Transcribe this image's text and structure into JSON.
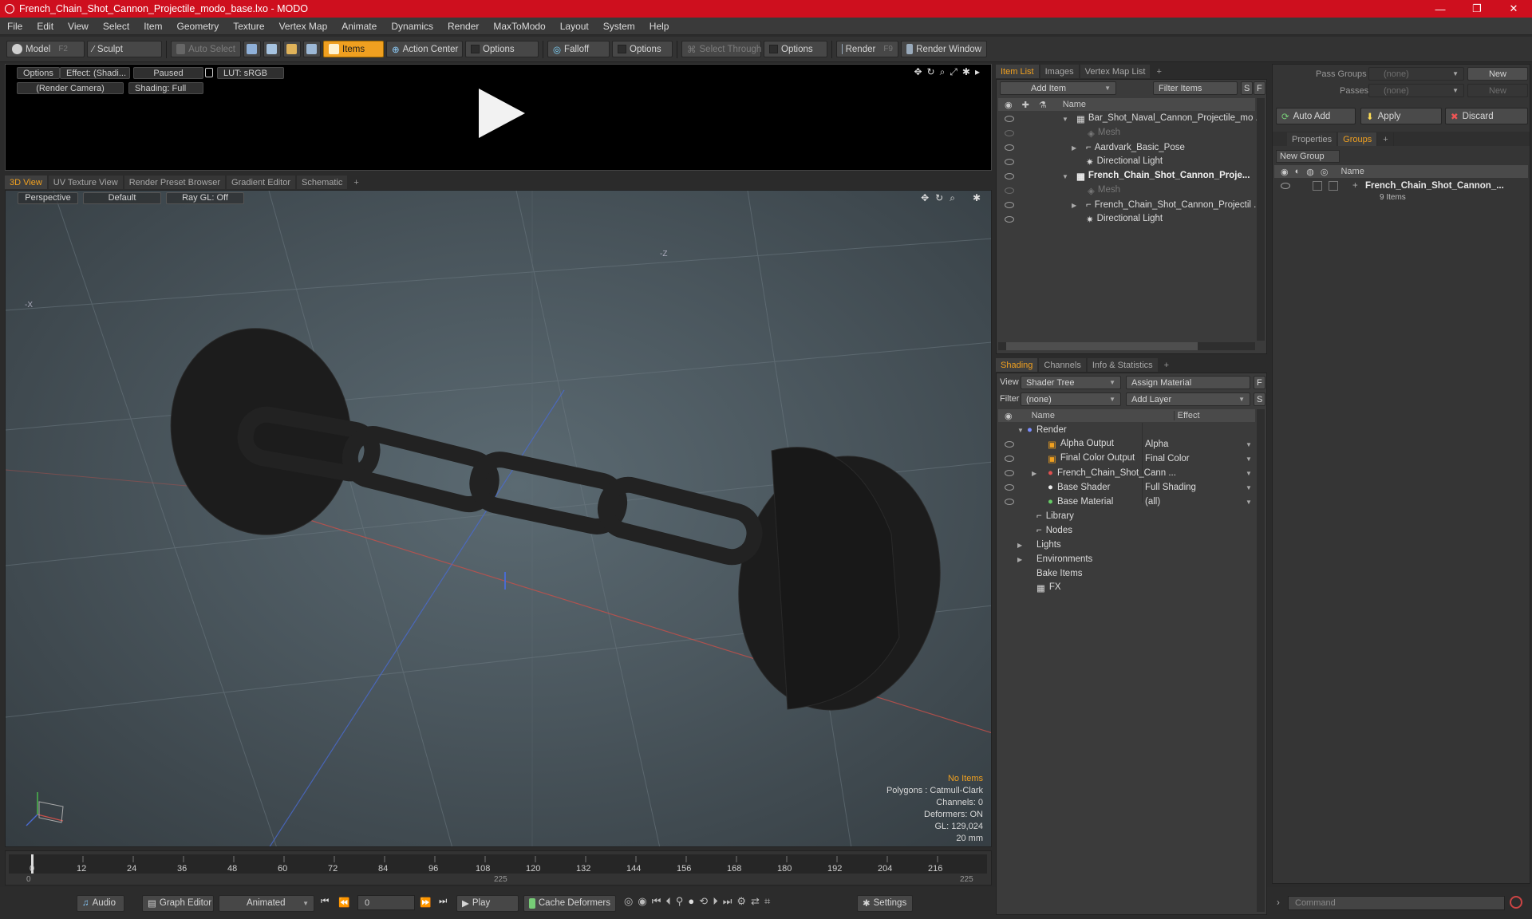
{
  "window": {
    "title": "French_Chain_Shot_Cannon_Projectile_modo_base.lxo - MODO",
    "minimize": "—",
    "maximize": "❐",
    "close": "✕"
  },
  "menu": [
    "File",
    "Edit",
    "View",
    "Select",
    "Item",
    "Geometry",
    "Texture",
    "Vertex Map",
    "Animate",
    "Dynamics",
    "Render",
    "MaxToModo",
    "Layout",
    "System",
    "Help"
  ],
  "toolbar": {
    "model": "Model",
    "model_key": "F2",
    "sculpt": "Sculpt",
    "auto_select": "Auto Select",
    "items": "Items",
    "action_center": "Action Center",
    "options1": "Options",
    "falloff": "Falloff",
    "options2": "Options",
    "select_through": "Select Through",
    "options3": "Options",
    "render": "Render",
    "render_key": "F9",
    "render_window": "Render Window"
  },
  "preview": {
    "options": "Options",
    "effect": "Effect: (Shadi...",
    "paused": "Paused",
    "lut": "LUT: sRGB",
    "camera": "(Render Camera)",
    "shading": "Shading: Full"
  },
  "viewport_tabs": [
    "3D View",
    "UV Texture View",
    "Render Preset Browser",
    "Gradient Editor",
    "Schematic",
    "+"
  ],
  "viewport": {
    "perspective": "Perspective",
    "default": "Default",
    "raygl": "Ray GL: Off",
    "axis_neg_x": "-X",
    "axis_neg_z": "-Z"
  },
  "hud": {
    "no_items": "No Items",
    "polygons": "Polygons : Catmull-Clark",
    "channels": "Channels: 0",
    "deformers": "Deformers: ON",
    "gl": "GL: 129,024",
    "unit": "20 mm"
  },
  "timeline": {
    "ticks": [
      "0",
      "12",
      "24",
      "36",
      "48",
      "60",
      "72",
      "84",
      "96",
      "108",
      "120",
      "132",
      "144",
      "156",
      "168",
      "180",
      "192",
      "204",
      "216"
    ],
    "lower": [
      "0",
      "225",
      "225"
    ]
  },
  "bottom": {
    "audio": "Audio",
    "graph_editor": "Graph Editor",
    "animated": "Animated",
    "frame": "0",
    "play": "Play",
    "cache": "Cache Deformers",
    "settings": "Settings"
  },
  "item_list": {
    "tabs": [
      "Item List",
      "Images",
      "Vertex Map List",
      "+"
    ],
    "add_item": "Add Item",
    "filter": "Filter Items",
    "s": "S",
    "f": "F",
    "col_name": "Name",
    "rows": [
      {
        "label": "Bar_Shot_Naval_Cannon_Projectile_mo ...",
        "indent": 0,
        "expand": "▼",
        "bold": false,
        "dim": false
      },
      {
        "label": "Mesh",
        "indent": 2,
        "expand": "",
        "bold": false,
        "dim": true
      },
      {
        "label": "Aardvark_Basic_Pose",
        "indent": 1,
        "expand": "▶",
        "bold": false,
        "dim": false
      },
      {
        "label": "Directional Light",
        "indent": 1,
        "expand": "",
        "bold": false,
        "dim": false
      },
      {
        "label": "French_Chain_Shot_Cannon_Proje...",
        "indent": 0,
        "expand": "▼",
        "bold": true,
        "dim": false
      },
      {
        "label": "Mesh",
        "indent": 2,
        "expand": "",
        "bold": false,
        "dim": true
      },
      {
        "label": "French_Chain_Shot_Cannon_Projectil ...",
        "indent": 1,
        "expand": "▶",
        "bold": false,
        "dim": false
      },
      {
        "label": "Directional Light",
        "indent": 1,
        "expand": "",
        "bold": false,
        "dim": false
      }
    ]
  },
  "shading": {
    "tabs": [
      "Shading",
      "Channels",
      "Info & Statistics",
      "+"
    ],
    "view_label": "View",
    "view_value": "Shader Tree",
    "assign": "Assign Material",
    "f": "F",
    "filter_label": "Filter",
    "filter_value": "(none)",
    "add_layer": "Add Layer",
    "s": "S",
    "col_name": "Name",
    "col_effect": "Effect",
    "rows": [
      {
        "label": "Render",
        "effect": "",
        "indent": 0,
        "eye": false
      },
      {
        "label": "Alpha Output",
        "effect": "Alpha",
        "indent": 1,
        "eye": true
      },
      {
        "label": "Final Color Output",
        "effect": "Final Color",
        "indent": 1,
        "eye": true
      },
      {
        "label": "French_Chain_Shot_Cann ...",
        "effect": "",
        "indent": 1,
        "eye": true
      },
      {
        "label": "Base Shader",
        "effect": "Full Shading",
        "indent": 1,
        "eye": true
      },
      {
        "label": "Base Material",
        "effect": "(all)",
        "indent": 1,
        "eye": true
      },
      {
        "label": "Library",
        "effect": "",
        "indent": 1,
        "eye": false
      },
      {
        "label": "Nodes",
        "effect": "",
        "indent": 1,
        "eye": false
      },
      {
        "label": "Lights",
        "effect": "",
        "indent": 0,
        "eye": false
      },
      {
        "label": "Environments",
        "effect": "",
        "indent": 0,
        "eye": false
      },
      {
        "label": "Bake Items",
        "effect": "",
        "indent": 0,
        "eye": false
      },
      {
        "label": "FX",
        "effect": "",
        "indent": 1,
        "eye": false
      }
    ]
  },
  "right": {
    "pass_groups": "Pass Groups",
    "passes": "Passes",
    "none": "(none)",
    "new": "New",
    "auto_add": "Auto Add",
    "apply": "Apply",
    "discard": "Discard",
    "tabs": [
      "Properties",
      "Groups",
      "+"
    ],
    "new_group": "New Group",
    "col_name": "Name",
    "group_name": "French_Chain_Shot_Cannon_...",
    "group_count": "9 Items",
    "command": "Command"
  }
}
